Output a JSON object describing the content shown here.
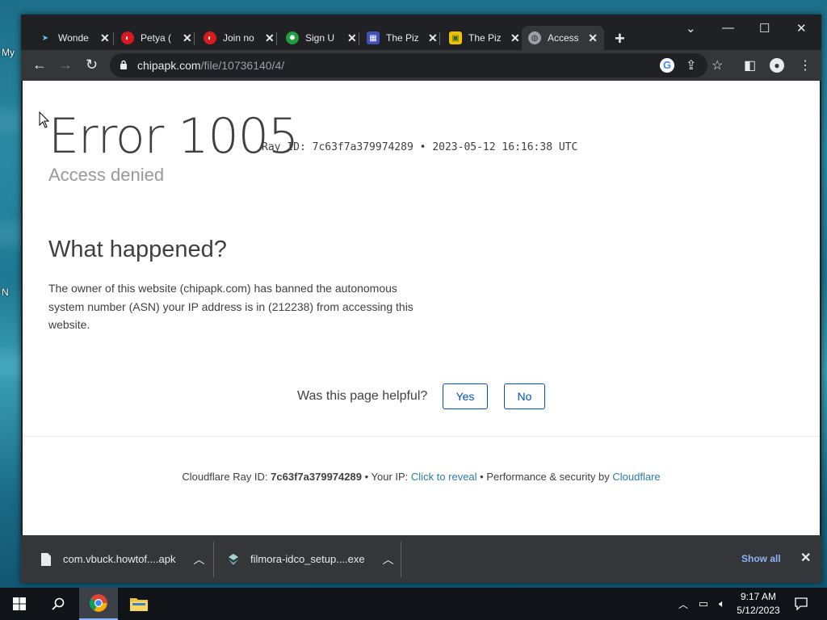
{
  "desktop": {
    "icon_labels": [
      "My",
      "N"
    ]
  },
  "tabs": [
    {
      "label": "Wonde",
      "icon": "wondershare-icon",
      "color": "#1f1f1f"
    },
    {
      "label": "Petya (",
      "icon": "trendmicro-icon",
      "color": "#d71920"
    },
    {
      "label": "Join no",
      "icon": "trendmicro-icon",
      "color": "#d71920"
    },
    {
      "label": "Sign U",
      "icon": "gear-badge-icon",
      "color": "#1e9e3e"
    },
    {
      "label": "The Piz",
      "icon": "calendar-icon",
      "color": "#4052b5"
    },
    {
      "label": "The Piz",
      "icon": "image-icon",
      "color": "#f2c200"
    },
    {
      "label": "Access",
      "icon": "globe-icon",
      "color": "#9aa0a6"
    }
  ],
  "address": {
    "host": "chipapk.com",
    "path": "/file/10736140/4/"
  },
  "page": {
    "error_title": "Error 1005",
    "ray_line": "Ray ID: 7c63f7a379974289 • 2023-05-12 16:16:38 UTC",
    "subtitle": "Access denied",
    "heading": "What happened?",
    "description": "The owner of this website (chipapk.com) has banned the autonomous system number (ASN) your IP address is in (212238) from accessing this website.",
    "helpful_question": "Was this page helpful?",
    "yes": "Yes",
    "no": "No",
    "footer": {
      "ray_label": "Cloudflare Ray ID:",
      "ray_id": "7c63f7a379974289",
      "ip_label": "• Your IP:",
      "reveal": "Click to reveal",
      "perf_label": "• Performance & security by",
      "cloudflare": "Cloudflare"
    }
  },
  "downloads": [
    {
      "name": "com.vbuck.howtof....apk"
    },
    {
      "name": "filmora-idco_setup....exe"
    }
  ],
  "shelf": {
    "show_all": "Show all"
  },
  "clock": {
    "time": "9:17 AM",
    "date": "5/12/2023"
  },
  "colors": {
    "link": "#2c7cb0",
    "button_blue": "#0051c3",
    "chrome_dark": "#202124"
  }
}
